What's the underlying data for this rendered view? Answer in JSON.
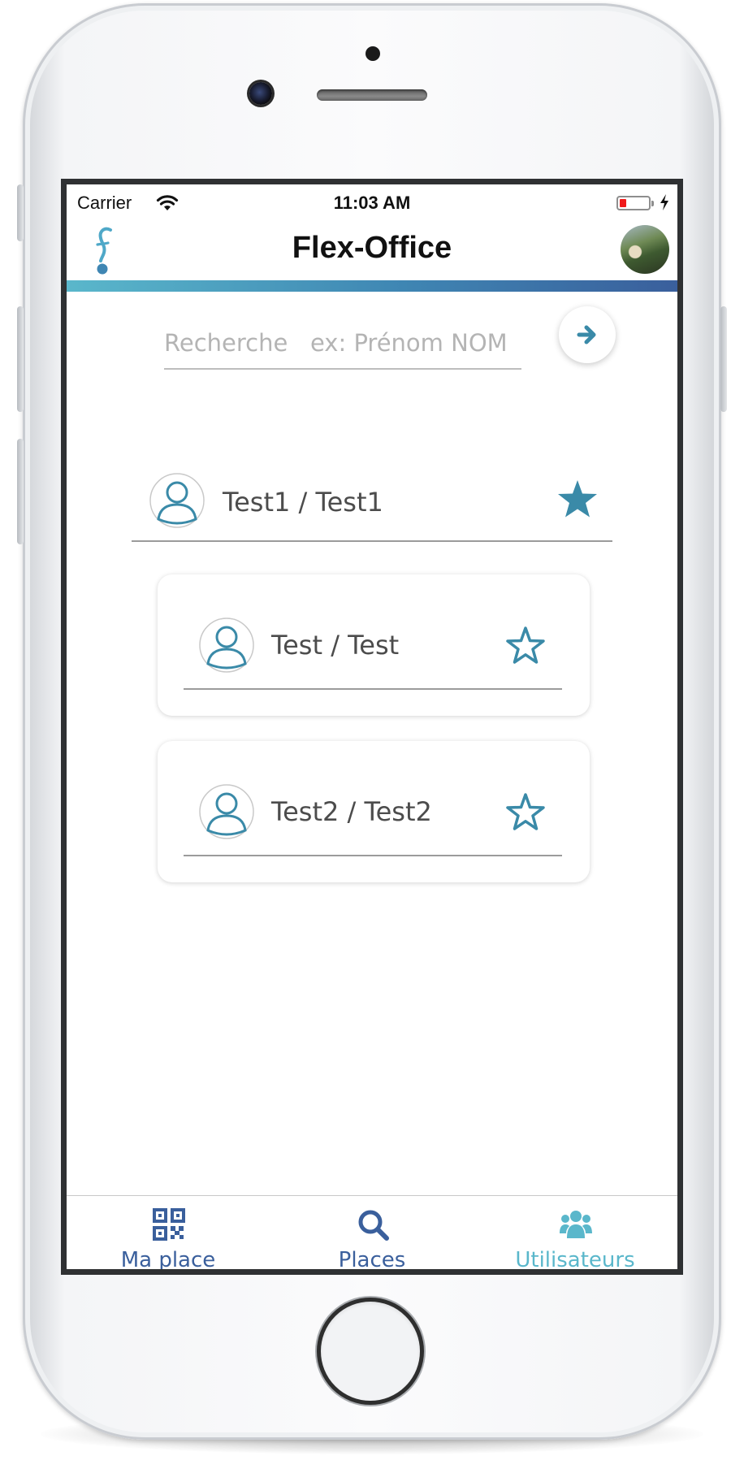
{
  "status_bar": {
    "carrier": "Carrier",
    "time": "11:03 AM",
    "battery_color": "#f0191a"
  },
  "header": {
    "title": "Flex-Office",
    "logo_icon": "flex-office-logo-icon",
    "avatar": "profile-avatar-photo",
    "gradient": [
      "#5ab7cb",
      "#3a5f9c"
    ]
  },
  "search": {
    "placeholder": "Recherche   ex: Prénom NOM",
    "value": "",
    "submit_icon": "arrow-right-icon"
  },
  "users": [
    {
      "name": "Test1 / Test1",
      "favorite": true
    },
    {
      "name": "Test / Test",
      "favorite": false
    },
    {
      "name": "Test2 / Test2",
      "favorite": false
    }
  ],
  "tabs": [
    {
      "label": "Ma place",
      "icon": "qr-code-icon",
      "color": "#3a5f9c",
      "active": false
    },
    {
      "label": "Places",
      "icon": "search-icon",
      "color": "#3a5f9c",
      "active": false
    },
    {
      "label": "Utilisateurs",
      "icon": "users-icon",
      "color": "#5ab7cb",
      "active": true
    }
  ],
  "colors": {
    "accent": "#3a8aa8",
    "tab_inactive": "#3a5f9c",
    "tab_active": "#5ab7cb"
  }
}
